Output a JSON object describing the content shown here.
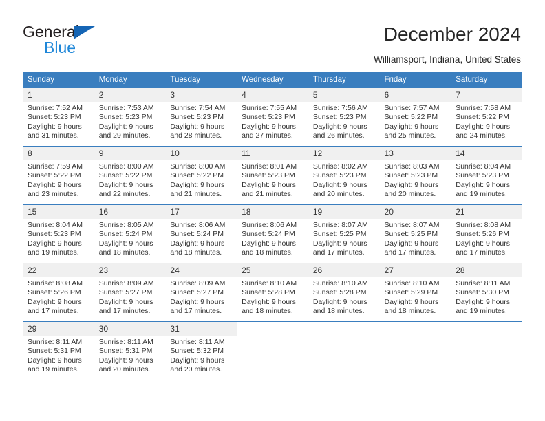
{
  "brand": {
    "name_primary": "General",
    "name_secondary": "Blue",
    "triangle_color": "#1565b5",
    "secondary_color": "#1f87d8"
  },
  "header": {
    "title": "December 2024",
    "subtitle": "Williamsport, Indiana, United States"
  },
  "theme": {
    "header_row_bg": "#3a7ebf",
    "header_row_text": "#ffffff",
    "daynum_bg": "#f0f0f0",
    "row_border": "#3a7ebf",
    "body_text": "#333333"
  },
  "calendar": {
    "weekday_headers": [
      "Sunday",
      "Monday",
      "Tuesday",
      "Wednesday",
      "Thursday",
      "Friday",
      "Saturday"
    ],
    "weeks": [
      [
        {
          "day": "1",
          "sunrise": "Sunrise: 7:52 AM",
          "sunset": "Sunset: 5:23 PM",
          "daylight": "Daylight: 9 hours and 31 minutes."
        },
        {
          "day": "2",
          "sunrise": "Sunrise: 7:53 AM",
          "sunset": "Sunset: 5:23 PM",
          "daylight": "Daylight: 9 hours and 29 minutes."
        },
        {
          "day": "3",
          "sunrise": "Sunrise: 7:54 AM",
          "sunset": "Sunset: 5:23 PM",
          "daylight": "Daylight: 9 hours and 28 minutes."
        },
        {
          "day": "4",
          "sunrise": "Sunrise: 7:55 AM",
          "sunset": "Sunset: 5:23 PM",
          "daylight": "Daylight: 9 hours and 27 minutes."
        },
        {
          "day": "5",
          "sunrise": "Sunrise: 7:56 AM",
          "sunset": "Sunset: 5:23 PM",
          "daylight": "Daylight: 9 hours and 26 minutes."
        },
        {
          "day": "6",
          "sunrise": "Sunrise: 7:57 AM",
          "sunset": "Sunset: 5:22 PM",
          "daylight": "Daylight: 9 hours and 25 minutes."
        },
        {
          "day": "7",
          "sunrise": "Sunrise: 7:58 AM",
          "sunset": "Sunset: 5:22 PM",
          "daylight": "Daylight: 9 hours and 24 minutes."
        }
      ],
      [
        {
          "day": "8",
          "sunrise": "Sunrise: 7:59 AM",
          "sunset": "Sunset: 5:22 PM",
          "daylight": "Daylight: 9 hours and 23 minutes."
        },
        {
          "day": "9",
          "sunrise": "Sunrise: 8:00 AM",
          "sunset": "Sunset: 5:22 PM",
          "daylight": "Daylight: 9 hours and 22 minutes."
        },
        {
          "day": "10",
          "sunrise": "Sunrise: 8:00 AM",
          "sunset": "Sunset: 5:22 PM",
          "daylight": "Daylight: 9 hours and 21 minutes."
        },
        {
          "day": "11",
          "sunrise": "Sunrise: 8:01 AM",
          "sunset": "Sunset: 5:23 PM",
          "daylight": "Daylight: 9 hours and 21 minutes."
        },
        {
          "day": "12",
          "sunrise": "Sunrise: 8:02 AM",
          "sunset": "Sunset: 5:23 PM",
          "daylight": "Daylight: 9 hours and 20 minutes."
        },
        {
          "day": "13",
          "sunrise": "Sunrise: 8:03 AM",
          "sunset": "Sunset: 5:23 PM",
          "daylight": "Daylight: 9 hours and 20 minutes."
        },
        {
          "day": "14",
          "sunrise": "Sunrise: 8:04 AM",
          "sunset": "Sunset: 5:23 PM",
          "daylight": "Daylight: 9 hours and 19 minutes."
        }
      ],
      [
        {
          "day": "15",
          "sunrise": "Sunrise: 8:04 AM",
          "sunset": "Sunset: 5:23 PM",
          "daylight": "Daylight: 9 hours and 19 minutes."
        },
        {
          "day": "16",
          "sunrise": "Sunrise: 8:05 AM",
          "sunset": "Sunset: 5:24 PM",
          "daylight": "Daylight: 9 hours and 18 minutes."
        },
        {
          "day": "17",
          "sunrise": "Sunrise: 8:06 AM",
          "sunset": "Sunset: 5:24 PM",
          "daylight": "Daylight: 9 hours and 18 minutes."
        },
        {
          "day": "18",
          "sunrise": "Sunrise: 8:06 AM",
          "sunset": "Sunset: 5:24 PM",
          "daylight": "Daylight: 9 hours and 18 minutes."
        },
        {
          "day": "19",
          "sunrise": "Sunrise: 8:07 AM",
          "sunset": "Sunset: 5:25 PM",
          "daylight": "Daylight: 9 hours and 17 minutes."
        },
        {
          "day": "20",
          "sunrise": "Sunrise: 8:07 AM",
          "sunset": "Sunset: 5:25 PM",
          "daylight": "Daylight: 9 hours and 17 minutes."
        },
        {
          "day": "21",
          "sunrise": "Sunrise: 8:08 AM",
          "sunset": "Sunset: 5:26 PM",
          "daylight": "Daylight: 9 hours and 17 minutes."
        }
      ],
      [
        {
          "day": "22",
          "sunrise": "Sunrise: 8:08 AM",
          "sunset": "Sunset: 5:26 PM",
          "daylight": "Daylight: 9 hours and 17 minutes."
        },
        {
          "day": "23",
          "sunrise": "Sunrise: 8:09 AM",
          "sunset": "Sunset: 5:27 PM",
          "daylight": "Daylight: 9 hours and 17 minutes."
        },
        {
          "day": "24",
          "sunrise": "Sunrise: 8:09 AM",
          "sunset": "Sunset: 5:27 PM",
          "daylight": "Daylight: 9 hours and 17 minutes."
        },
        {
          "day": "25",
          "sunrise": "Sunrise: 8:10 AM",
          "sunset": "Sunset: 5:28 PM",
          "daylight": "Daylight: 9 hours and 18 minutes."
        },
        {
          "day": "26",
          "sunrise": "Sunrise: 8:10 AM",
          "sunset": "Sunset: 5:28 PM",
          "daylight": "Daylight: 9 hours and 18 minutes."
        },
        {
          "day": "27",
          "sunrise": "Sunrise: 8:10 AM",
          "sunset": "Sunset: 5:29 PM",
          "daylight": "Daylight: 9 hours and 18 minutes."
        },
        {
          "day": "28",
          "sunrise": "Sunrise: 8:11 AM",
          "sunset": "Sunset: 5:30 PM",
          "daylight": "Daylight: 9 hours and 19 minutes."
        }
      ],
      [
        {
          "day": "29",
          "sunrise": "Sunrise: 8:11 AM",
          "sunset": "Sunset: 5:31 PM",
          "daylight": "Daylight: 9 hours and 19 minutes."
        },
        {
          "day": "30",
          "sunrise": "Sunrise: 8:11 AM",
          "sunset": "Sunset: 5:31 PM",
          "daylight": "Daylight: 9 hours and 20 minutes."
        },
        {
          "day": "31",
          "sunrise": "Sunrise: 8:11 AM",
          "sunset": "Sunset: 5:32 PM",
          "daylight": "Daylight: 9 hours and 20 minutes."
        },
        {
          "day": "",
          "sunrise": "",
          "sunset": "",
          "daylight": ""
        },
        {
          "day": "",
          "sunrise": "",
          "sunset": "",
          "daylight": ""
        },
        {
          "day": "",
          "sunrise": "",
          "sunset": "",
          "daylight": ""
        },
        {
          "day": "",
          "sunrise": "",
          "sunset": "",
          "daylight": ""
        }
      ]
    ]
  }
}
